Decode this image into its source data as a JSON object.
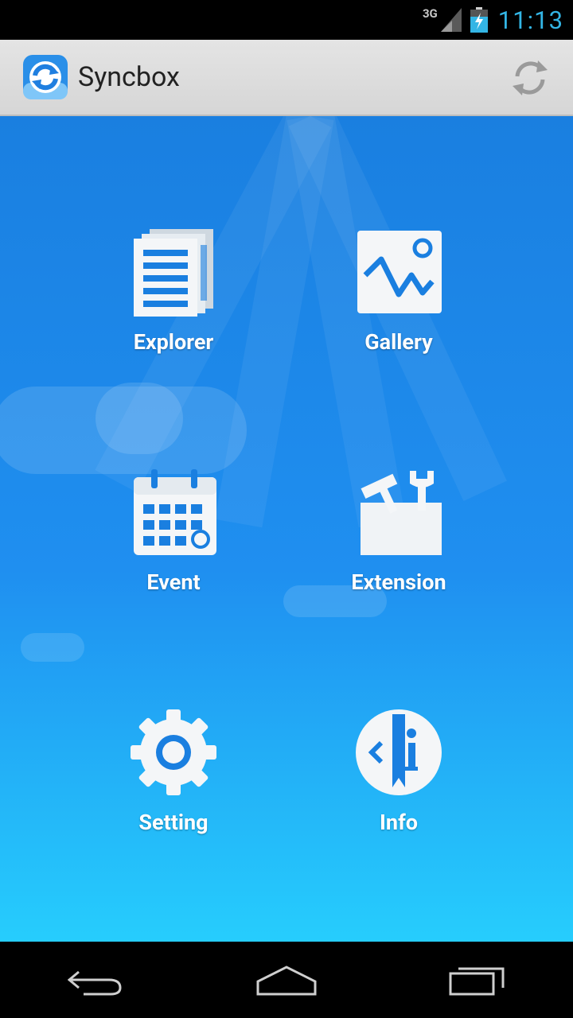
{
  "status_bar": {
    "network": "3G",
    "time": "11:13"
  },
  "action_bar": {
    "title": "Syncbox"
  },
  "tiles": [
    {
      "label": "Explorer",
      "icon": "documents-icon"
    },
    {
      "label": "Gallery",
      "icon": "picture-icon"
    },
    {
      "label": "Event",
      "icon": "calendar-icon"
    },
    {
      "label": "Extension",
      "icon": "toolbox-icon"
    },
    {
      "label": "Setting",
      "icon": "gear-icon"
    },
    {
      "label": "Info",
      "icon": "info-icon"
    }
  ],
  "nav_bar": {
    "back_icon": "back-icon",
    "home_icon": "home-icon",
    "recents_icon": "recents-icon"
  },
  "colors": {
    "accent": "#33b5e5",
    "background_top": "#1a7fe0",
    "background_bottom": "#26cdfd",
    "icon_blue": "#1a7fe0"
  }
}
